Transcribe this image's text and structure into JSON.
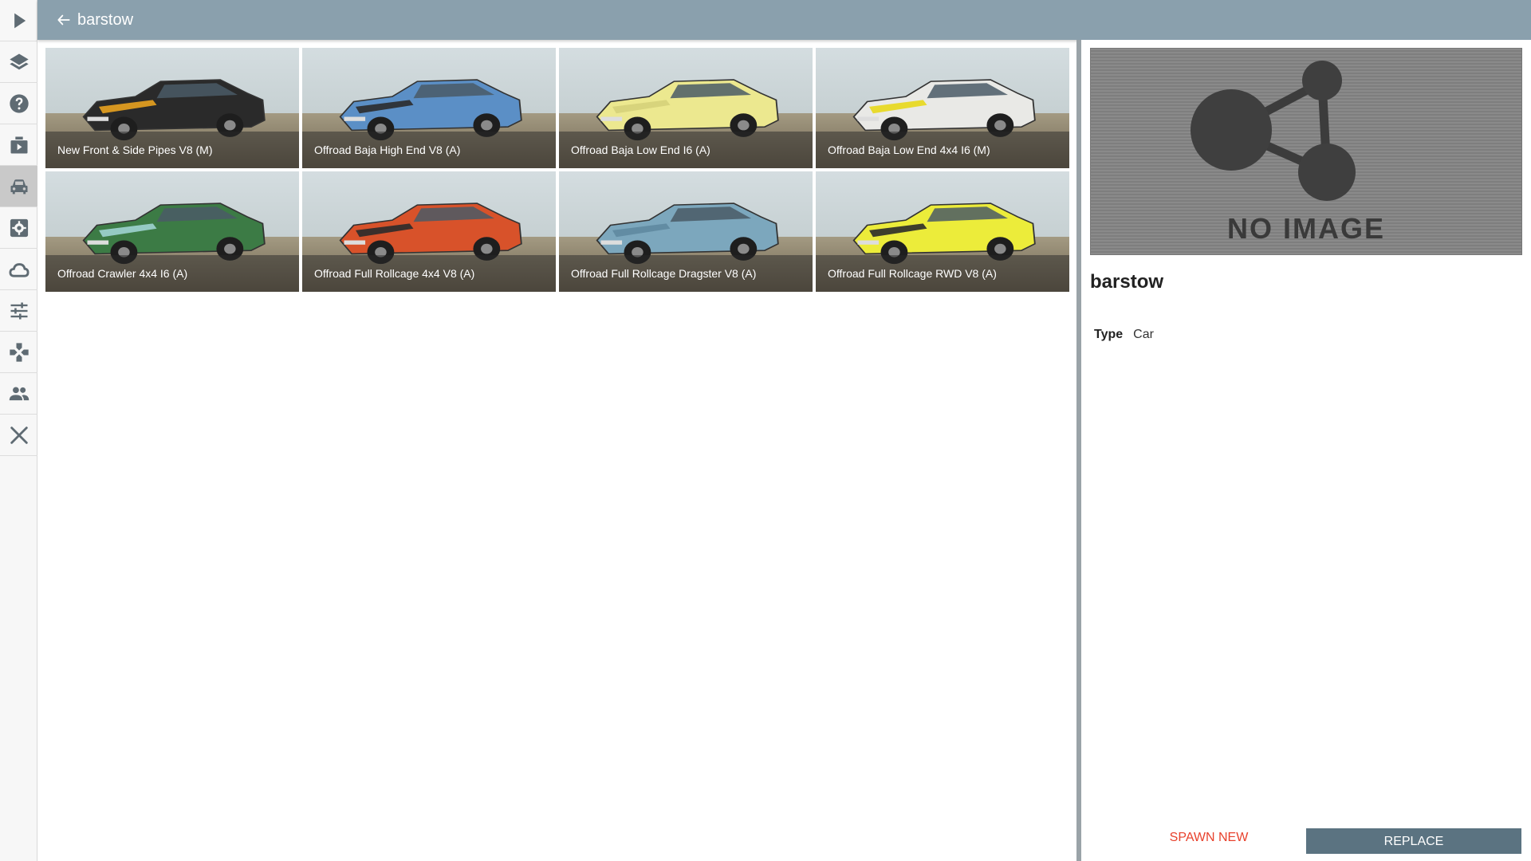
{
  "header": {
    "title": "barstow"
  },
  "sidebar": {
    "items": [
      {
        "icon": "play-icon"
      },
      {
        "icon": "layers-icon"
      },
      {
        "icon": "help-icon"
      },
      {
        "icon": "video-icon"
      },
      {
        "icon": "car-icon",
        "active": true
      },
      {
        "icon": "settings-icon"
      },
      {
        "icon": "cloud-icon"
      },
      {
        "icon": "sliders-icon"
      },
      {
        "icon": "gamepad-icon"
      },
      {
        "icon": "people-icon"
      },
      {
        "icon": "close-icon"
      }
    ]
  },
  "configs": [
    {
      "label": "New Front & Side Pipes V8 (M)",
      "color": "#2a2a2a",
      "accent": "#e8a21f"
    },
    {
      "label": "Offroad Baja High End V8 (A)",
      "color": "#5b8fc6",
      "accent": "#2b2b2b"
    },
    {
      "label": "Offroad Baja Low End I6 (A)",
      "color": "#ece88f",
      "accent": "#d6d27a"
    },
    {
      "label": "Offroad Baja Low End 4x4 I6 (M)",
      "color": "#e9e9e6",
      "accent": "#e8d81a"
    },
    {
      "label": "Offroad Crawler 4x4 I6 (A)",
      "color": "#3c7b45",
      "accent": "#9fd3d0"
    },
    {
      "label": "Offroad Full Rollcage 4x4 V8 (A)",
      "color": "#d8522a",
      "accent": "#2b2b2b"
    },
    {
      "label": "Offroad Full Rollcage Dragster V8 (A)",
      "color": "#7ca7bd",
      "accent": "#5f8aa0"
    },
    {
      "label": "Offroad Full Rollcage RWD V8 (A)",
      "color": "#ecec3a",
      "accent": "#2b2b2b"
    }
  ],
  "details": {
    "image_text": "NO IMAGE",
    "name": "barstow",
    "type_label": "Type",
    "type_value": "Car"
  },
  "actions": {
    "spawn_label": "SPAWN NEW",
    "replace_label": "REPLACE"
  }
}
